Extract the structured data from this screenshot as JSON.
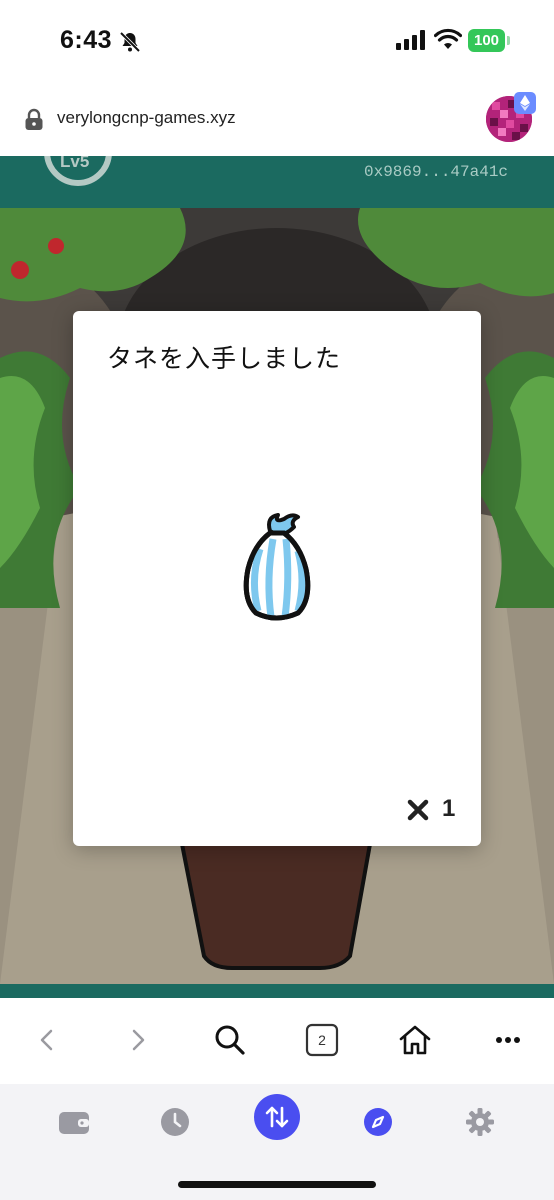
{
  "status_bar": {
    "time": "6:43",
    "battery": "100",
    "icons": [
      "bell-slash-icon",
      "cellular-signal-icon",
      "wifi-icon",
      "battery-icon"
    ]
  },
  "browser": {
    "url": "verylongcnp-games.xyz",
    "tab_count": "2",
    "toolbar_icons": [
      "back-icon",
      "forward-icon",
      "search-icon",
      "tabs-icon",
      "home-icon",
      "more-icon"
    ]
  },
  "game": {
    "level_label": "Lv5",
    "wallet_address": "0x9869...47a41c"
  },
  "modal": {
    "title": "タネを入手しました",
    "item_icon": "seed-bag-icon",
    "quantity_prefix_icon": "close-x-icon",
    "quantity": "1"
  },
  "wallet_nav": {
    "items": [
      "wallet-icon",
      "history-icon",
      "swap-icon",
      "explore-icon",
      "settings-icon"
    ],
    "active": "swap-icon",
    "accent": "#4a4ef0"
  },
  "colors": {
    "header_teal": "#1b6a60",
    "battery_green": "#34c759",
    "seed_blue": "#7ec8ee"
  }
}
